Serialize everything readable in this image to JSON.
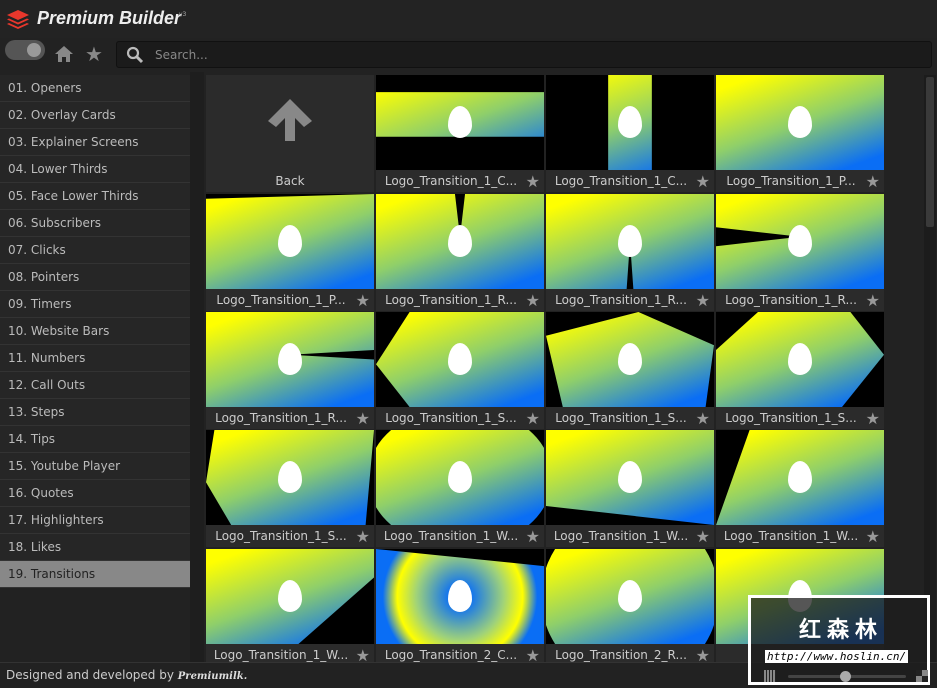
{
  "app": {
    "title": "Premium Builder",
    "version": "v3"
  },
  "toolbar": {
    "search_placeholder": "Search..."
  },
  "sidebar": {
    "items": [
      "01. Openers",
      "02. Overlay Cards",
      "03. Explainer Screens",
      "04. Lower Thirds",
      "05. Face Lower Thirds",
      "06. Subscribers",
      "07. Clicks",
      "08. Pointers",
      "09. Timers",
      "10. Website Bars",
      "11. Numbers",
      "12. Call Outs",
      "13. Steps",
      "14. Tips",
      "15. Youtube Player",
      "16. Quotes",
      "17. Highlighters",
      "18. Likes",
      "19. Transitions"
    ],
    "active": "19. Transitions"
  },
  "grid": {
    "back_label": "Back",
    "items": [
      "Logo_Transition_1_C...",
      "Logo_Transition_1_C...",
      "Logo_Transition_1_P...",
      "Logo_Transition_1_P...",
      "Logo_Transition_1_R...",
      "Logo_Transition_1_R...",
      "Logo_Transition_1_R...",
      "Logo_Transition_1_R...",
      "Logo_Transition_1_S...",
      "Logo_Transition_1_S...",
      "Logo_Transition_1_S...",
      "Logo_Transition_1_S...",
      "Logo_Transition_1_W...",
      "Logo_Transition_1_W...",
      "Logo_Transition_1_W...",
      "Logo_Transition_1_W...",
      "Logo_Transition_2_C...",
      "Logo_Transition_2_R...",
      "Logo..."
    ]
  },
  "footer": {
    "credit": "Designed and developed by",
    "brand": "Premiumilk."
  },
  "watermark": {
    "text": "红森林",
    "url": "http://www.hoslin.cn/"
  },
  "colors": {
    "accent": "#e8372c",
    "active_item": "#888888"
  }
}
